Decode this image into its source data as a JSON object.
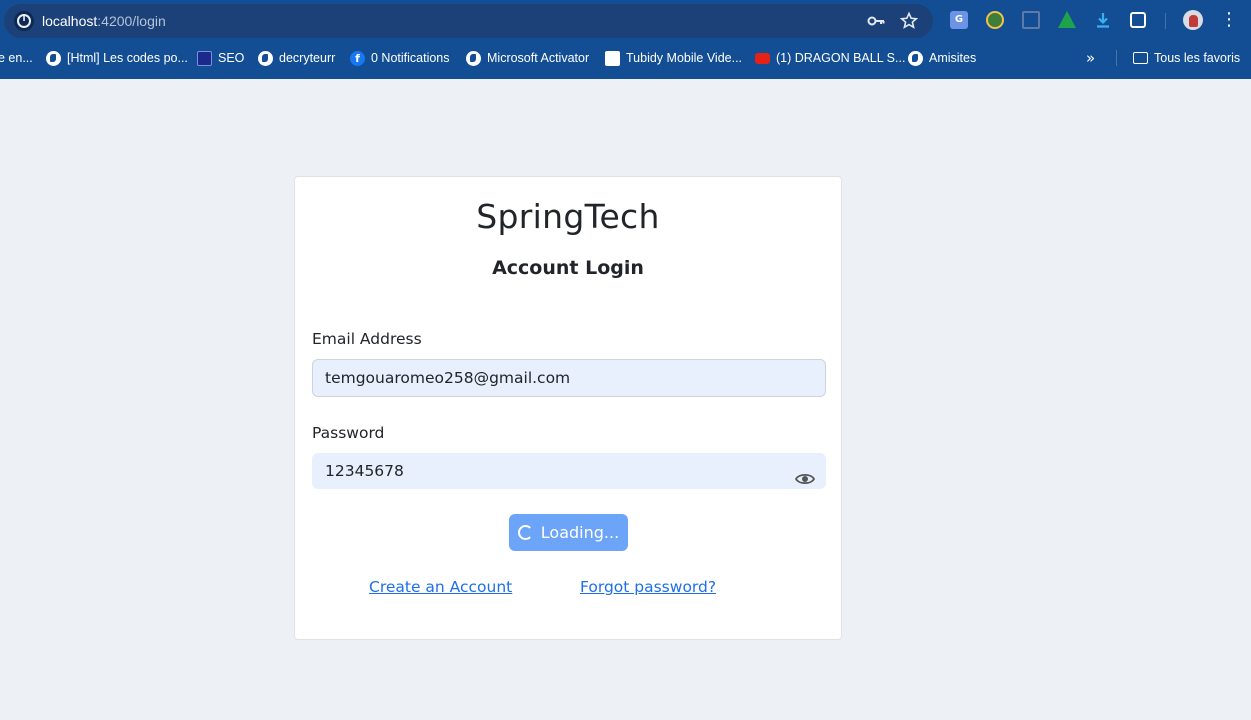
{
  "browser": {
    "url_host": "localhost",
    "url_path": ":4200/login",
    "icons": [
      "info-icon",
      "key-icon",
      "star-icon",
      "translate-icon",
      "globe-extension-icon",
      "document-extension-icon",
      "tree-extension-icon",
      "download-icon",
      "puzzle-icon",
      "avatar",
      "more-menu-icon"
    ]
  },
  "bookmarks": {
    "items": [
      {
        "label": "e en...",
        "icon": "none"
      },
      {
        "label": "[Html] Les codes po...",
        "icon": "globe-icon"
      },
      {
        "label": "SEO",
        "icon": "seo-icon"
      },
      {
        "label": "decryteurr",
        "icon": "globe-icon"
      },
      {
        "label": "0 Notifications",
        "icon": "facebook-icon"
      },
      {
        "label": "Microsoft Activator",
        "icon": "globe-icon"
      },
      {
        "label": "Tubidy Mobile Vide...",
        "icon": "tubidy-icon"
      },
      {
        "label": "(1) DRAGON BALL S...",
        "icon": "youtube-icon"
      },
      {
        "label": "Amisites",
        "icon": "globe-icon"
      }
    ],
    "overflow_glyph": "»",
    "all_bookmarks_label": "Tous les favoris"
  },
  "login": {
    "brand": "SpringTech",
    "title": "Account Login",
    "email_label": "Email Address",
    "email_value": "temgouaromeo258@gmail.com",
    "password_label": "Password",
    "password_value": "12345678",
    "submit_label": "Loading...",
    "create_account_link": "Create an Account",
    "forgot_password_link": "Forgot password?"
  },
  "colors": {
    "chrome": "#134e94",
    "page_bg": "#edf1f5",
    "input_bg": "#e8f0fe",
    "button_bg": "#6ca4f7",
    "link": "#1f6feb"
  }
}
